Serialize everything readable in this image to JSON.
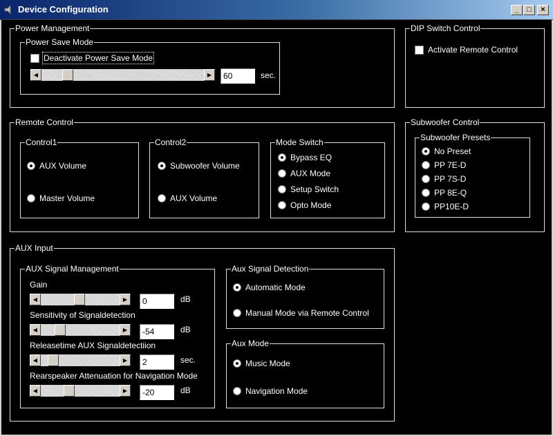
{
  "window": {
    "title": "Device Configuration",
    "minimize": "_",
    "maximize": "□",
    "close": "×"
  },
  "power_management": {
    "label": "Power Management",
    "power_save": {
      "label": "Power Save Mode",
      "checkbox_label": "Deactivate Power Save Mode",
      "checked": false,
      "value": "60",
      "unit": "sec."
    }
  },
  "dip_switch": {
    "label": "DIP Switch Control",
    "checkbox_label": "Activate Remote Control",
    "checked": false
  },
  "remote_control": {
    "label": "Remote Control",
    "control1": {
      "label": "Control1",
      "options": [
        "AUX Volume",
        "Master Volume"
      ],
      "selected": 0
    },
    "control2": {
      "label": "Control2",
      "options": [
        "Subwoofer Volume",
        "AUX Volume"
      ],
      "selected": 0
    },
    "mode_switch": {
      "label": "Mode Switch",
      "options": [
        "Bypass EQ",
        "AUX Mode",
        "Setup Switch",
        "Opto Mode"
      ],
      "selected": 0
    }
  },
  "subwoofer_control": {
    "label": "Subwoofer Control",
    "presets": {
      "label": "Subwoofer Presets",
      "options": [
        "No Preset",
        "PP 7E-D",
        "PP 7S-D",
        "PP 8E-Q",
        "PP10E-D"
      ],
      "selected": 0
    }
  },
  "aux_input": {
    "label": "AUX Input",
    "signal_management": {
      "label": "AUX Signal Management",
      "gain": {
        "label": "Gain",
        "value": "0",
        "unit": "dB"
      },
      "sensitivity": {
        "label": "Sensitivity of Signaldetection",
        "value": "-54",
        "unit": "dB"
      },
      "releasetime": {
        "label": "Releasetime AUX Signaldetectiion",
        "value": "2",
        "unit": "sec."
      },
      "rearspeaker": {
        "label": "Rearspeaker Attenuation for Navigation Mode",
        "value": "-20",
        "unit": "dB"
      }
    },
    "signal_detection": {
      "label": "Aux Signal Detection",
      "options": [
        "Automatic Mode",
        "Manual Mode via Remote Control"
      ],
      "selected": 0
    },
    "aux_mode": {
      "label": "Aux Mode",
      "options": [
        "Music Mode",
        "Navigation Mode"
      ],
      "selected": 0
    }
  },
  "icons": {
    "app": "speaker-icon",
    "left_arrow": "◀",
    "right_arrow": "▶"
  }
}
